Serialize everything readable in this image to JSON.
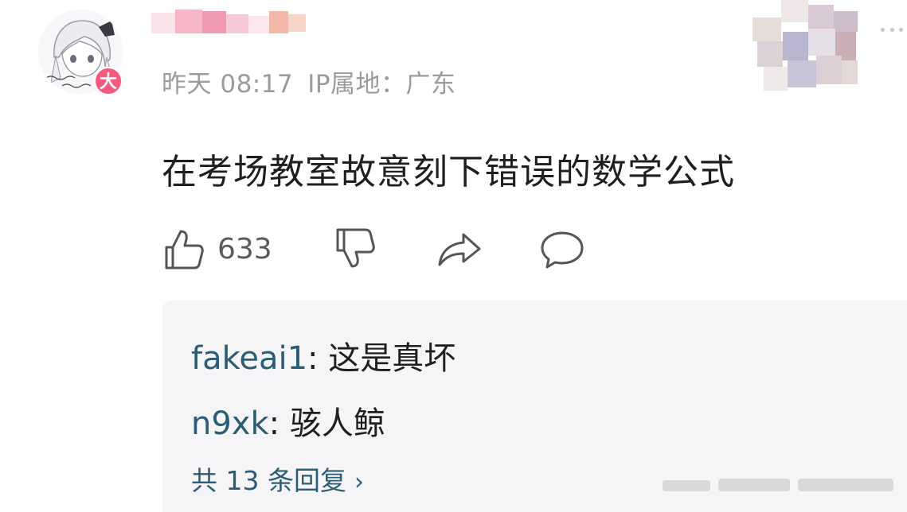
{
  "post": {
    "avatar_icon": "anime-avatar-icon",
    "badge_label": "大",
    "badge_color": "#f35a7d",
    "meta_date": "昨天 08:17",
    "meta_ip": "IP属地：广东",
    "content": "在考场教室故意刻下错误的数学公式"
  },
  "actions": {
    "like_icon": "thumbs-up-icon",
    "like_count": "633",
    "dislike_icon": "thumbs-down-icon",
    "share_icon": "share-arrow-icon",
    "comment_icon": "comment-bubble-icon"
  },
  "replies": {
    "items": [
      {
        "user": "fakeai1",
        "separator": ": ",
        "text": "这是真坏"
      },
      {
        "user": "n9xk",
        "separator": ": ",
        "text": "骇人鲸"
      }
    ],
    "more_label": "共 13 条回复",
    "more_icon": "chevron-right-icon"
  },
  "colors": {
    "username_link": "#2b5d74",
    "meta_gray": "#9b9b9b",
    "reply_bg": "#f5f5f7"
  }
}
